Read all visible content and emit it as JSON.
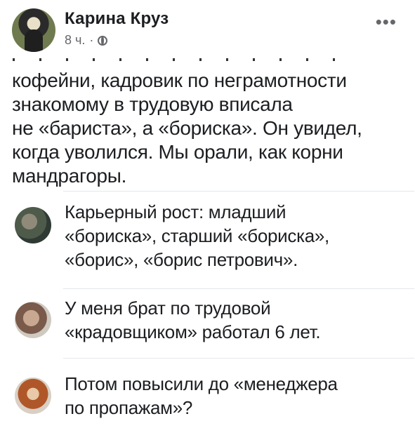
{
  "post": {
    "author": "Карина Круз",
    "time": "8 ч.",
    "separator": "·",
    "body_lines": [
      "кофейни, кадровик по неграмотности",
      "знакомому в трудовую вписала",
      "не «бариста», а «бориска». Он увидел,",
      "когда уволился. Мы орали, как корни",
      "мандрагоры."
    ]
  },
  "icons": {
    "more": "more-options-icon",
    "privacy": "globe-icon"
  },
  "comments": [
    {
      "lines": [
        "Карьерный рост: младший",
        "«бориска», старший «бориска»,",
        "«борис», «борис петрович»."
      ]
    },
    {
      "lines": [
        "У меня брат по трудовой",
        "«крадовщиком» работал 6 лет."
      ]
    },
    {
      "lines": [
        "Потом повысили до «менеджера",
        "по пропажам»?"
      ]
    }
  ]
}
